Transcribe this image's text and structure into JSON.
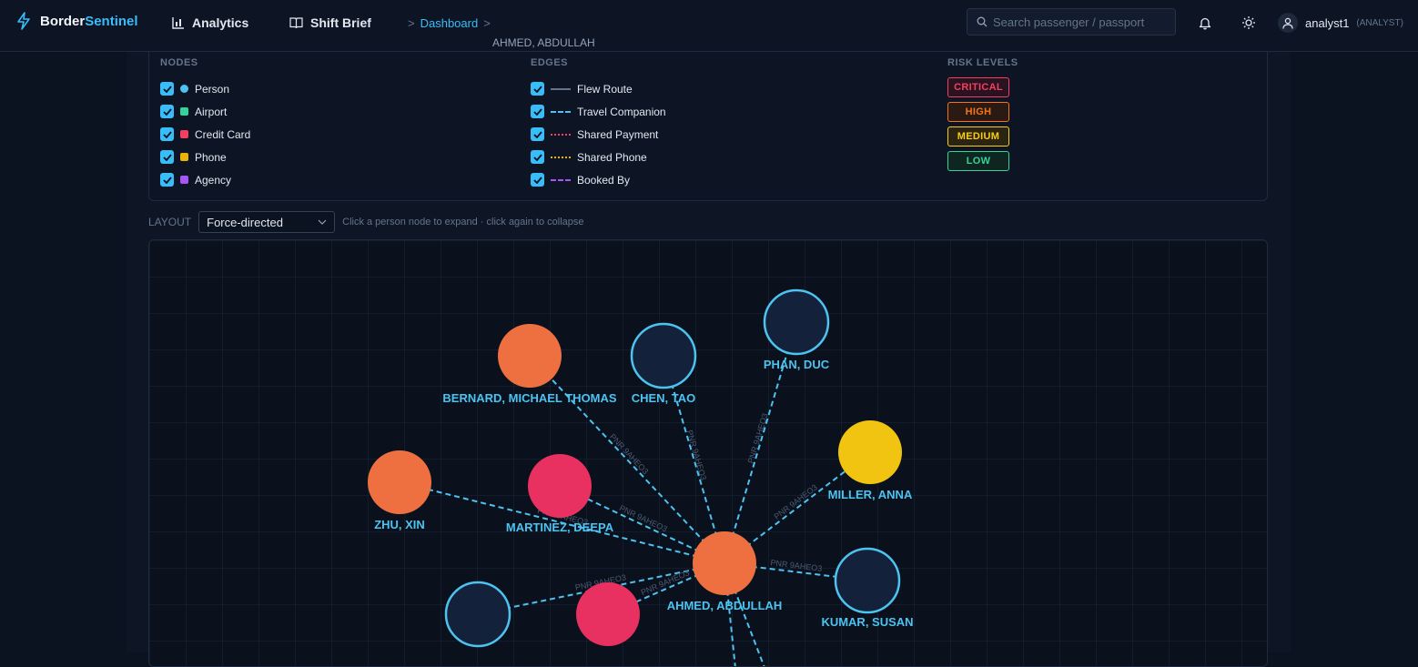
{
  "app": {
    "brand_part1": "Border",
    "brand_part2": "Sentinel"
  },
  "nav": {
    "analytics": "Analytics",
    "shift_brief": "Shift Brief"
  },
  "breadcrumb": {
    "sep1": ">",
    "dashboard": "Dashboard",
    "sep2": ">",
    "current": "AHMED, ABDULLAH"
  },
  "search": {
    "placeholder": "Search passenger / passport",
    "value": ""
  },
  "user": {
    "name": "analyst1",
    "role": "(ANALYST)"
  },
  "legend": {
    "nodes_title": "NODES",
    "nodes": [
      {
        "label": "Person",
        "color": "#4cc3f0",
        "shape": "circle",
        "checked": true
      },
      {
        "label": "Airport",
        "color": "#34d399",
        "shape": "square",
        "checked": true
      },
      {
        "label": "Credit Card",
        "color": "#f43f5e",
        "shape": "square",
        "checked": true
      },
      {
        "label": "Phone",
        "color": "#eab308",
        "shape": "square",
        "checked": true
      },
      {
        "label": "Agency",
        "color": "#a855f7",
        "shape": "square",
        "checked": true
      }
    ],
    "edges_title": "EDGES",
    "edges": [
      {
        "label": "Flew Route",
        "color": "#64748b",
        "style": "solid",
        "checked": true
      },
      {
        "label": "Travel Companion",
        "color": "#4cc3f0",
        "style": "dashed",
        "checked": true
      },
      {
        "label": "Shared Payment",
        "color": "#f43f5e",
        "style": "dotted",
        "checked": true
      },
      {
        "label": "Shared Phone",
        "color": "#eab308",
        "style": "dotted",
        "checked": true
      },
      {
        "label": "Booked By",
        "color": "#a855f7",
        "style": "dashed",
        "checked": true
      }
    ],
    "risk_title": "RISK LEVELS",
    "risk": [
      {
        "label": "CRITICAL",
        "color": "#f43f5e",
        "bg": "#2a1220"
      },
      {
        "label": "HIGH",
        "color": "#f97316",
        "bg": "#2a1a14"
      },
      {
        "label": "MEDIUM",
        "color": "#facc15",
        "bg": "#2a2410"
      },
      {
        "label": "LOW",
        "color": "#34d399",
        "bg": "#0f2620"
      }
    ]
  },
  "layout": {
    "label": "LAYOUT",
    "selected": "Force-directed",
    "hint": "Click a person node to expand · click again to collapse"
  },
  "graph": {
    "edge_label": "PNR 9AHEO3",
    "nodes": [
      {
        "id": "center",
        "label": "AHMED, ABDULLAH",
        "fill": "#ee7040",
        "risk": "HIGH"
      },
      {
        "id": "bernard",
        "label": "BERNARD, MICHAEL THOMAS",
        "fill": "#ee7040",
        "risk": "HIGH"
      },
      {
        "id": "chen",
        "label": "CHEN, TAO",
        "fill": "#13223a",
        "risk": "NONE"
      },
      {
        "id": "phan",
        "label": "PHAN, DUC",
        "fill": "#13223a",
        "risk": "NONE"
      },
      {
        "id": "miller",
        "label": "MILLER, ANNA",
        "fill": "#f0c410",
        "risk": "MEDIUM"
      },
      {
        "id": "zhu",
        "label": "ZHU, XIN",
        "fill": "#ee7040",
        "risk": "HIGH"
      },
      {
        "id": "martinez",
        "label": "MARTINEZ, DEEPA",
        "fill": "#e83160",
        "risk": "CRITICAL"
      },
      {
        "id": "kumar",
        "label": "KUMAR, SUSAN",
        "fill": "#13223a",
        "risk": "NONE"
      },
      {
        "id": "bl",
        "label": "",
        "fill": "#13223a",
        "risk": "NONE"
      },
      {
        "id": "br",
        "label": "",
        "fill": "#e83160",
        "risk": "CRITICAL"
      }
    ]
  }
}
